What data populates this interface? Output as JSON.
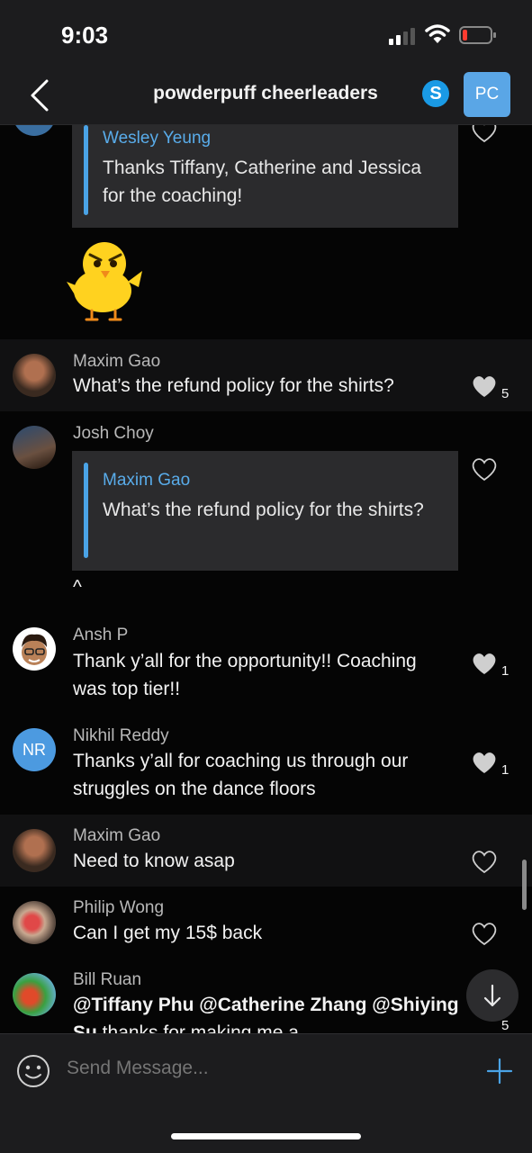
{
  "status": {
    "time": "9:03"
  },
  "header": {
    "back_label": "",
    "title": "powderpuff cheerleaders",
    "skype_glyph": "S",
    "avatar_initials": "PC"
  },
  "messages": [
    {
      "quote_name": "Wesley Yeung",
      "quote_text": "Thanks Tiffany, Catherine and Jessica for the coaching!",
      "sticker": "chick-sticker"
    },
    {
      "name": "Maxim Gao",
      "text": "What’s the refund policy for the shirts?",
      "likes": "5"
    },
    {
      "name": "Josh Choy",
      "quote_name": "Maxim Gao",
      "quote_text": "What’s the refund policy for the shirts?",
      "text": "^"
    },
    {
      "name": "Ansh P",
      "text": "Thank y’all for the opportunity!! Coaching was top tier!!",
      "likes": "1"
    },
    {
      "name": "Nikhil Reddy",
      "initials": "NR",
      "text": "Thanks y’all for coaching us through our struggles on the dance floors",
      "likes": "1"
    },
    {
      "name": "Maxim Gao",
      "text": "Need to know asap"
    },
    {
      "name": "Philip Wong",
      "text": "Can I get my 15$ back"
    },
    {
      "name": "Bill Ruan",
      "mention_1": "@Tiffany Phu",
      "mention_2": "@Catherine Zhang",
      "mention_3": "@Shiying Su",
      "text": " thanks for making me a",
      "likes": "5"
    }
  ],
  "composer": {
    "placeholder": "Send Message..."
  },
  "colors": {
    "accent": "#4aa3e6",
    "background": "#000000",
    "bar": "#1c1c1e"
  }
}
